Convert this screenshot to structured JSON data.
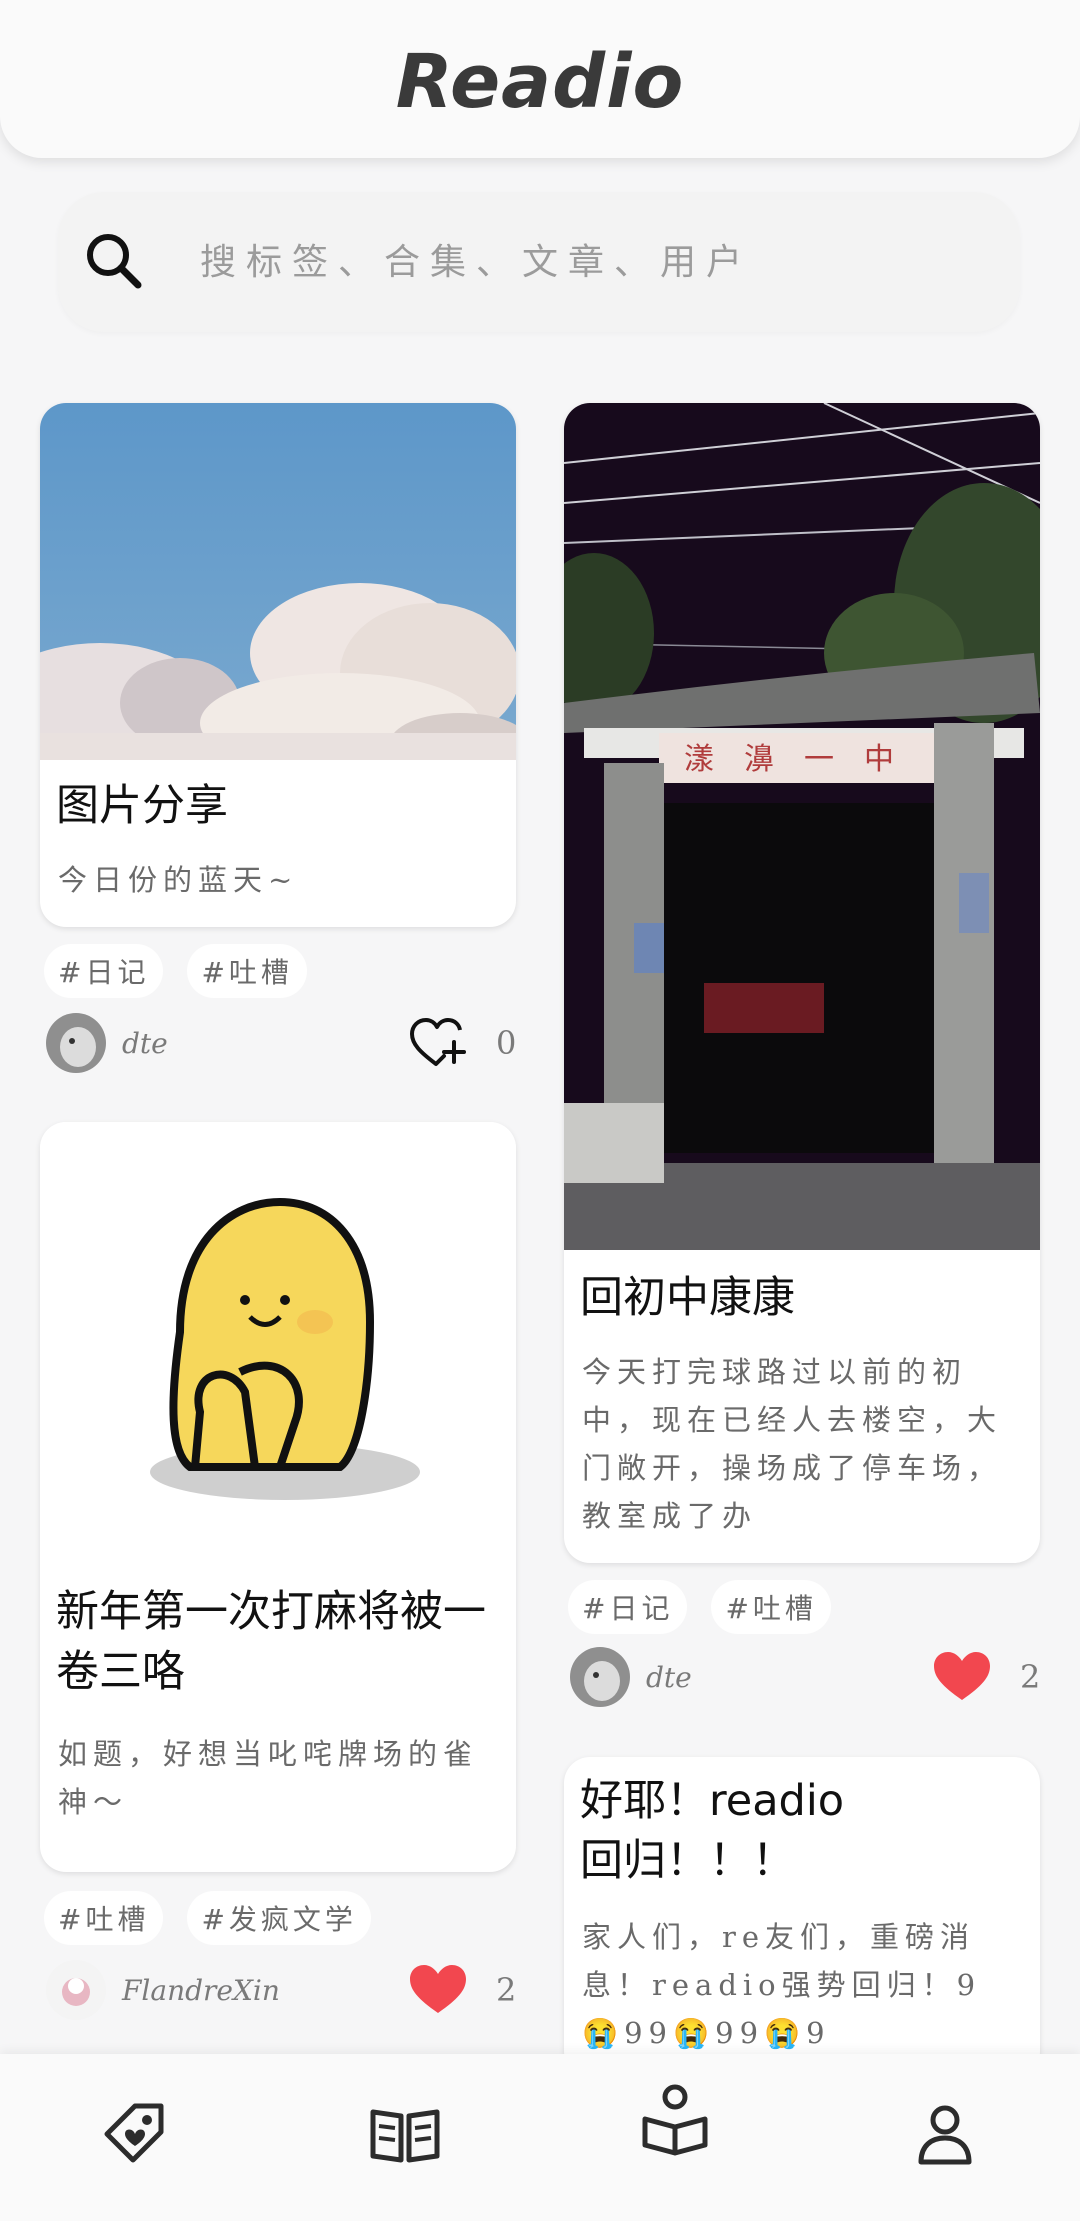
{
  "app": {
    "title": "Readio"
  },
  "search": {
    "placeholder": "搜标签、合集、文章、用户"
  },
  "posts": [
    {
      "title": "图片分享",
      "excerpt": "今日份的蓝天~",
      "tags": [
        "#日记",
        "#吐槽"
      ],
      "author": "dte",
      "liked": false,
      "likes": "0",
      "image": "blue sky with clouds"
    },
    {
      "title": "回初中康康",
      "excerpt": "今天打完球路过以前的初中，现在已经人去楼空，大门敞开，操场成了停车场，教室成了办",
      "tags": [
        "#日记",
        "#吐槽"
      ],
      "author": "dte",
      "liked": true,
      "likes": "2",
      "image": "school gate at night",
      "image_text": "漾濞一中"
    },
    {
      "title": "新年第一次打麻将被一卷三咯",
      "excerpt": "如题，好想当叱咤牌场的雀神～",
      "tags": [
        "#吐槽",
        "#发疯文学"
      ],
      "author": "FlandreXin",
      "liked": true,
      "likes": "2",
      "image": "yellow blob cartoon"
    },
    {
      "title": "好耶！readio回归！！！",
      "excerpt": "家人们，re友们，重磅消息！readio强势回归！9😭99😭99😭9"
    }
  ],
  "tabbar": {
    "items": [
      "tags-icon",
      "book-icon",
      "reader-icon",
      "profile-icon"
    ],
    "active": "reader-icon"
  },
  "colors": {
    "like_red": "#f2474f",
    "background": "#f6f6f7",
    "card": "#ffffff"
  }
}
